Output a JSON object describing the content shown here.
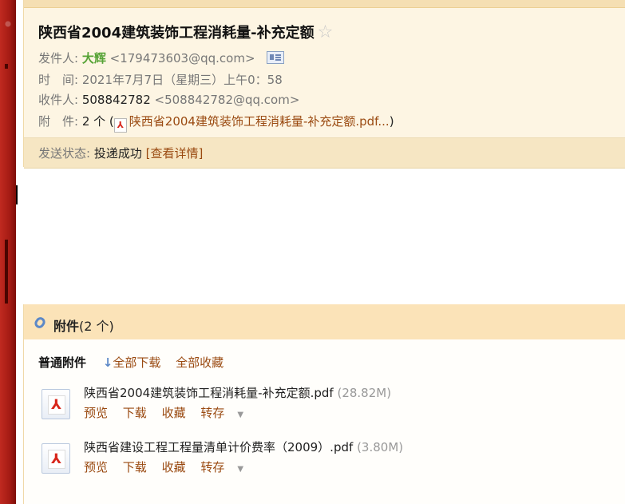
{
  "email": {
    "subject": "陕西省2004建筑装饰工程消耗量-补充定额",
    "star": "☆",
    "sender_label": "发件人:",
    "sender_name": "大辉",
    "sender_email": "<179473603@qq.com>",
    "time_label": "时　间:",
    "time_value": "2021年7月7日（星期三）上午0：58",
    "recipient_label": "收件人:",
    "recipient_name": "508842782",
    "recipient_email": "<508842782@qq.com>",
    "attach_label": "附　件:",
    "attach_count": "2 个 (",
    "attach_preview": "陕西省2004建筑装饰工程消耗量-补充定额.pdf...",
    "attach_close": ")",
    "status_label": "发送状态:",
    "status_value": "投递成功",
    "status_link": "[查看详情]"
  },
  "attachments": {
    "title": "附件",
    "count": "(2 个)",
    "section_label": "普通附件",
    "download_all": "全部下载",
    "collect_all": "全部收藏",
    "files": [
      {
        "name": "陕西省2004建筑装饰工程消耗量-补充定额.pdf",
        "size": "(28.82M)",
        "actions": [
          "预览",
          "下载",
          "收藏",
          "转存"
        ]
      },
      {
        "name": "陕西省建设工程工程量清单计价费率（2009）.pdf",
        "size": "(3.80M)",
        "actions": [
          "预览",
          "下载",
          "收藏",
          "转存"
        ]
      }
    ]
  },
  "colors": {
    "header_bg": "#fdf5e3",
    "status_bg": "#f6e6c3",
    "link": "#9a4a11",
    "sender_green": "#56a336"
  }
}
